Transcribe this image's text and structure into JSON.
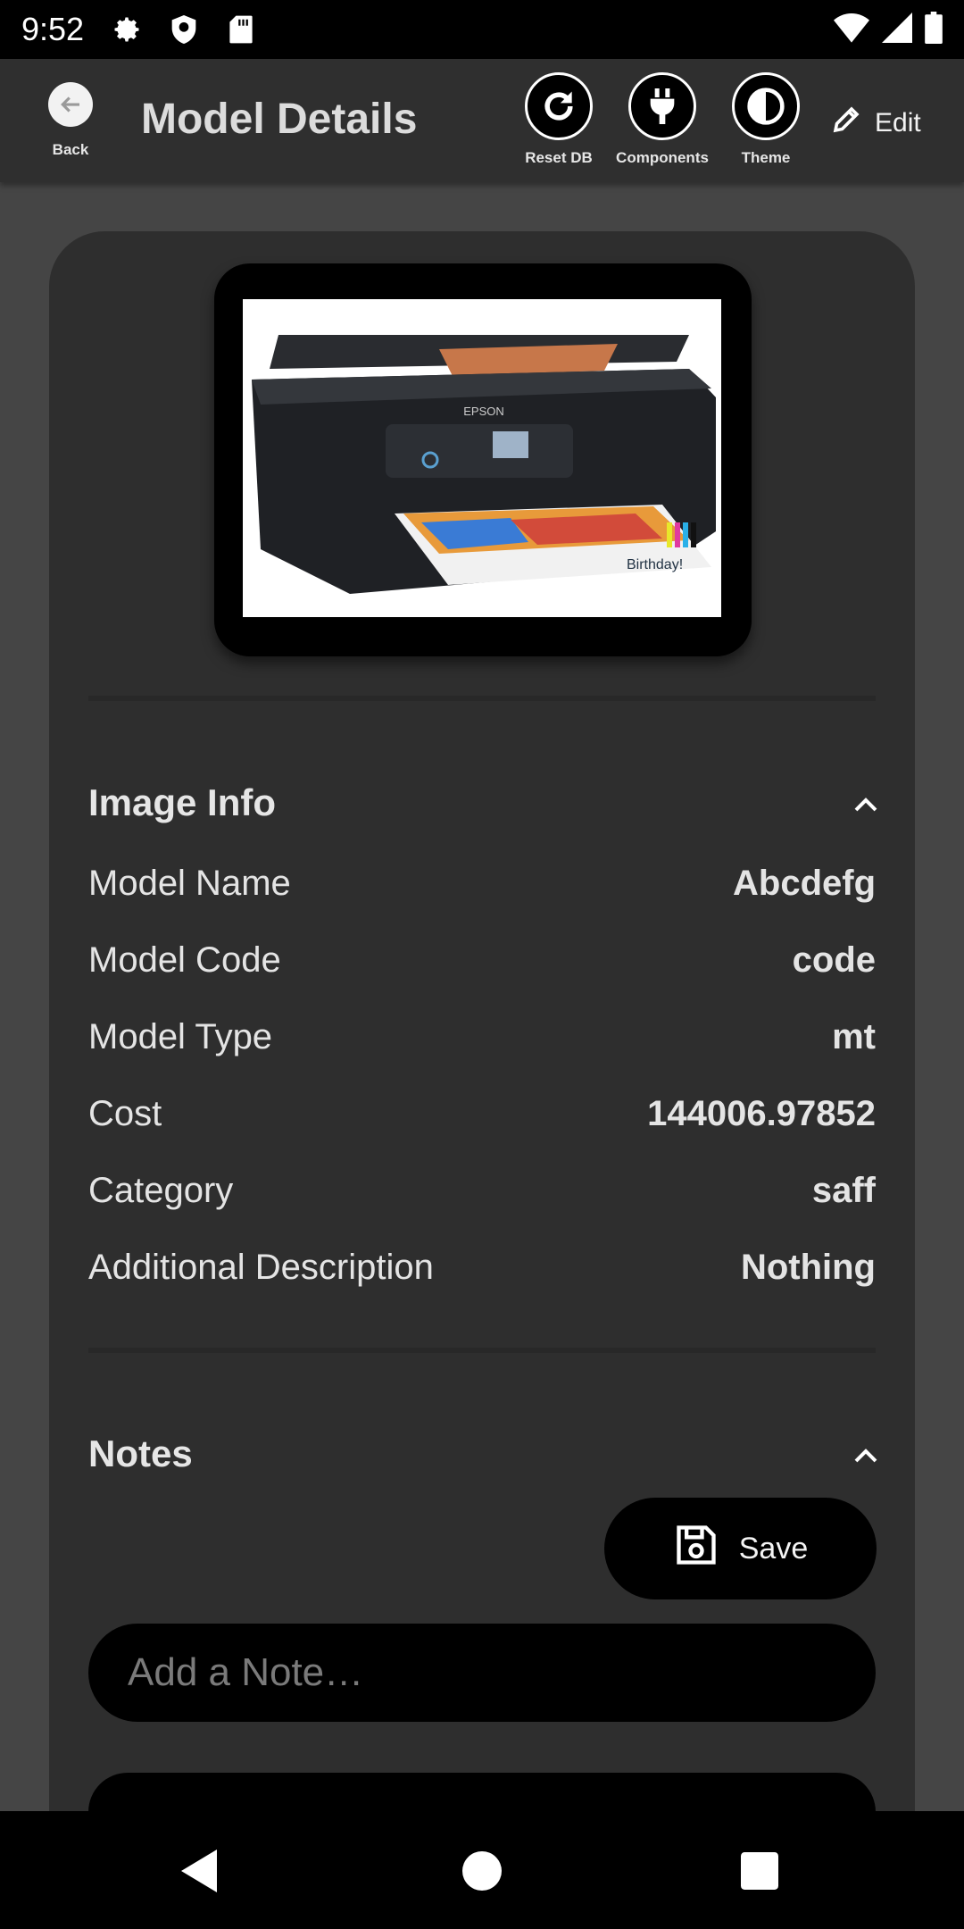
{
  "status_bar": {
    "time": "9:52"
  },
  "app_bar": {
    "back_label": "Back",
    "title": "Model Details",
    "actions": [
      {
        "label": "Reset DB",
        "icon": "refresh-icon"
      },
      {
        "label": "Components",
        "icon": "plug-icon"
      },
      {
        "label": "Theme",
        "icon": "theme-icon"
      }
    ],
    "edit_label": "Edit"
  },
  "image_info": {
    "title": "Image Info",
    "rows": [
      {
        "label": "Model Name",
        "value": "Abcdefg"
      },
      {
        "label": "Model Code",
        "value": "code"
      },
      {
        "label": "Model Type",
        "value": "mt"
      },
      {
        "label": "Cost",
        "value": "144006.97852"
      },
      {
        "label": "Category",
        "value": "saff"
      },
      {
        "label": "Additional Description",
        "value": "Nothing"
      }
    ]
  },
  "notes": {
    "title": "Notes",
    "save_label": "Save",
    "input_placeholder": "Add a Note…"
  },
  "image": {
    "brand_text": "EPSON",
    "banner_text": "Birthday!"
  },
  "colors": {
    "background": "#454545",
    "card": "#2e2e2e",
    "appbar": "#2f2f2f"
  }
}
